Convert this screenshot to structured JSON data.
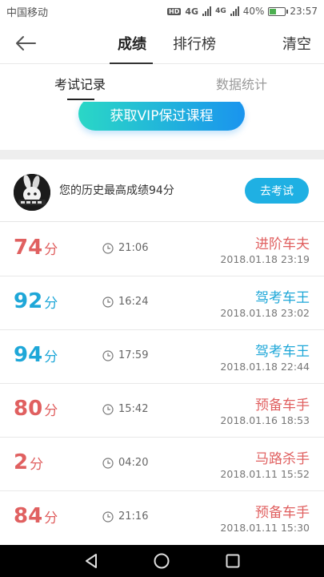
{
  "status_bar": {
    "carrier": "中国移动",
    "sim_badge": "HD",
    "network_a": "4G",
    "network_b": "4G",
    "battery": "40%",
    "battery_level": 0.4,
    "time": "23:57"
  },
  "header": {
    "tabs": [
      {
        "label": "成绩",
        "active": true
      },
      {
        "label": "排行榜",
        "active": false
      }
    ],
    "clear_label": "清空"
  },
  "subtabs": [
    {
      "label": "考试记录",
      "active": true
    },
    {
      "label": "数据统计",
      "active": false
    }
  ],
  "vip_button": "获取VIP保过课程",
  "best": {
    "text": "您的历史最高成绩94分",
    "button": "去考试"
  },
  "records": [
    {
      "score": "74",
      "unit": "分",
      "duration": "21:06",
      "title": "进阶车夫",
      "datetime": "2018.01.18  23:19",
      "color": "red"
    },
    {
      "score": "92",
      "unit": "分",
      "duration": "16:24",
      "title": "驾考车王",
      "datetime": "2018.01.18  23:02",
      "color": "blue"
    },
    {
      "score": "94",
      "unit": "分",
      "duration": "17:59",
      "title": "驾考车王",
      "datetime": "2018.01.18  22:44",
      "color": "blue"
    },
    {
      "score": "80",
      "unit": "分",
      "duration": "15:42",
      "title": "预备车手",
      "datetime": "2018.01.16  18:53",
      "color": "red"
    },
    {
      "score": "2",
      "unit": "分",
      "duration": "04:20",
      "title": "马路杀手",
      "datetime": "2018.01.11  15:52",
      "color": "red"
    },
    {
      "score": "84",
      "unit": "分",
      "duration": "21:16",
      "title": "预备车手",
      "datetime": "2018.01.11  15:30",
      "color": "red"
    }
  ],
  "colors": {
    "red": "#e06060",
    "blue": "#1ea7d8",
    "button_blue": "#1fb0e3"
  }
}
